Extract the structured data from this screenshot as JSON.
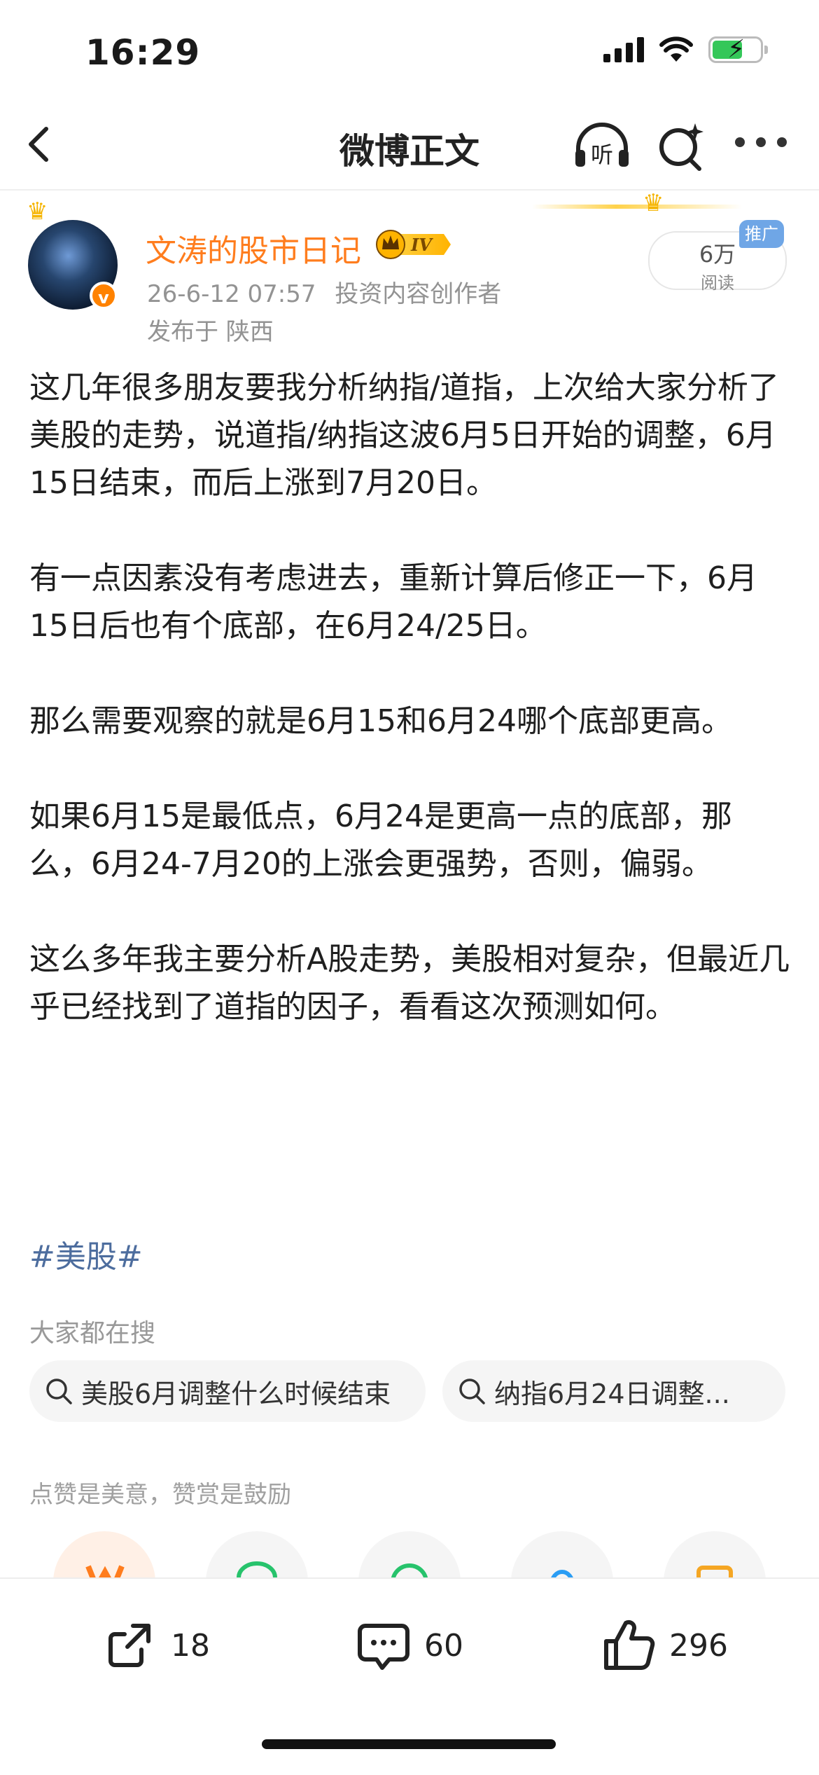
{
  "status_bar": {
    "time": "16:29"
  },
  "nav": {
    "title": "微博正文",
    "listen_label": "听"
  },
  "author": {
    "name": "文涛的股市日记",
    "level_badge": "IV",
    "badge_letter": "v",
    "date": "26-6-12 07:57",
    "role": "投资内容创作者",
    "location": "发布于 陕西"
  },
  "read_stats": {
    "count": "6万",
    "label": "阅读",
    "promo": "推广"
  },
  "post": {
    "paragraphs": [
      "这几年很多朋友要我分析纳指/道指，上次给大家分析了美股的走势，说道指/纳指这波6月5日开始的调整，6月15日结束，而后上涨到7月20日。",
      "有一点因素没有考虑进去，重新计算后修正一下，6月15日后也有个底部，在6月24/25日。",
      "那么需要观察的就是6月15和6月24哪个底部更高。",
      "如果6月15是最低点，6月24是更高一点的底部，那么，6月24-7月20的上涨会更强势，否则，偏弱。",
      "这么多年我主要分析A股走势，美股相对复杂，但最近几乎已经找到了道指的因子，看看这次预测如何。"
    ],
    "hashtag": "#美股#"
  },
  "search": {
    "heading": "大家都在搜",
    "chips": [
      "美股6月调整什么时候结束",
      "纳指6月24日调整..."
    ]
  },
  "reward": {
    "heading": "点赞是美意，赞赏是鼓励"
  },
  "actions": {
    "share_count": "18",
    "comment_count": "60",
    "like_count": "296"
  },
  "colors": {
    "author": "#ff7d1e",
    "hashtag": "#4d6d9e",
    "promo": "#6fa6e6",
    "gold": "#f5b400"
  }
}
